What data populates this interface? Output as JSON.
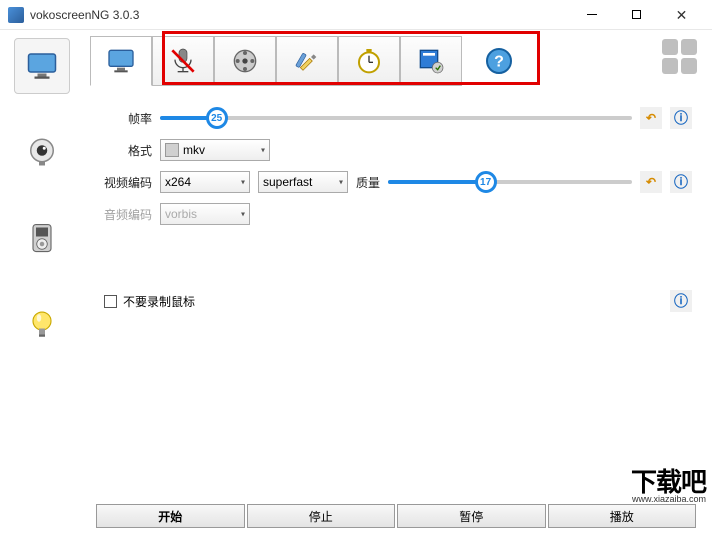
{
  "window": {
    "title": "vokoscreenNG 3.0.3"
  },
  "settings": {
    "framerate": {
      "label": "帧率",
      "value": 25,
      "min": 1,
      "max": 144
    },
    "format": {
      "label": "格式",
      "value": "mkv"
    },
    "videoCodec": {
      "label": "视频编码",
      "value": "x264",
      "preset": "superfast",
      "qualityLabel": "质量",
      "qualityValue": 17
    },
    "audioCodec": {
      "label": "音频编码",
      "value": "vorbis"
    },
    "noRecordMouse": {
      "label": "不要录制鼠标",
      "checked": false
    }
  },
  "buttons": {
    "start": "开始",
    "stop": "停止",
    "pause": "暂停",
    "play": "播放"
  },
  "watermark": {
    "big": "下载吧",
    "url": "www.xiazaiba.com"
  }
}
